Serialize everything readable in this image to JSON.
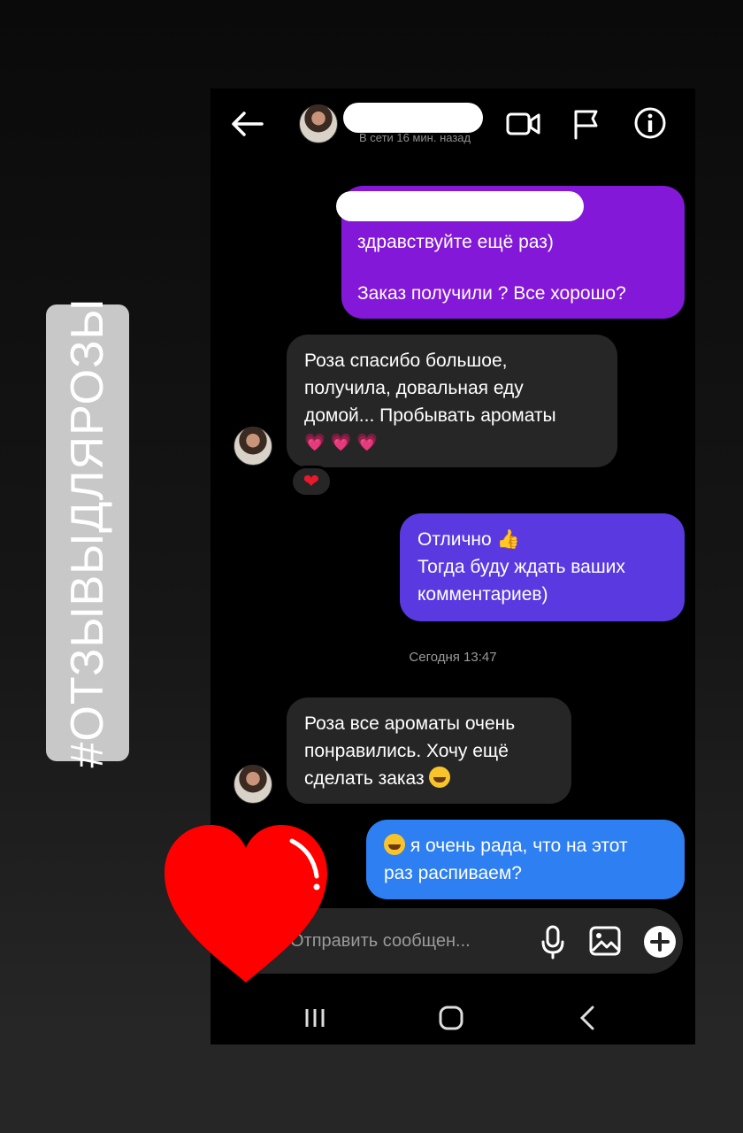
{
  "header": {
    "status": "В сети 16 мин. назад"
  },
  "messages": {
    "m1_line1": "здравствуйте ещё раз)",
    "m1_line2": "Заказ получили ? Все хорошо?",
    "m2_line1": "Роза спасибо большое,",
    "m2_line2": "получила, довальная еду",
    "m2_line3": "домой... Пробывать ароматы",
    "m2_emoji": "💗💗💗",
    "m2_reaction": "❤",
    "m3_line1": "Отлично",
    "m3_emoji": "👍",
    "m3_line2": "Тогда буду ждать ваших",
    "m3_line3": "комментариев)",
    "timestamp": "Сегодня 13:47",
    "m4_line1": "Роза все ароматы очень",
    "m4_line2": "понравились. Хочу ещё",
    "m4_line3": "сделать заказ",
    "m5_line1": "я очень рада, что на этот",
    "m5_line2": "раз распиваем?"
  },
  "composer": {
    "placeholder": "Отправить сообщен..."
  },
  "sticker": {
    "hashtag": "#ОТЗЫВЫДЛЯРОЗЫ"
  },
  "colors": {
    "outgoing_purple": "#8418d8",
    "outgoing_indigo": "#5a3ae0",
    "outgoing_blue": "#2d7ff2",
    "incoming": "#262626",
    "heart": "#ff0000"
  },
  "icons": [
    "back-arrow-icon",
    "video-call-icon",
    "flag-icon",
    "info-icon",
    "microphone-icon",
    "image-icon",
    "plus-icon",
    "recent-apps-icon",
    "home-icon",
    "nav-back-icon",
    "heart-sticker-icon"
  ]
}
